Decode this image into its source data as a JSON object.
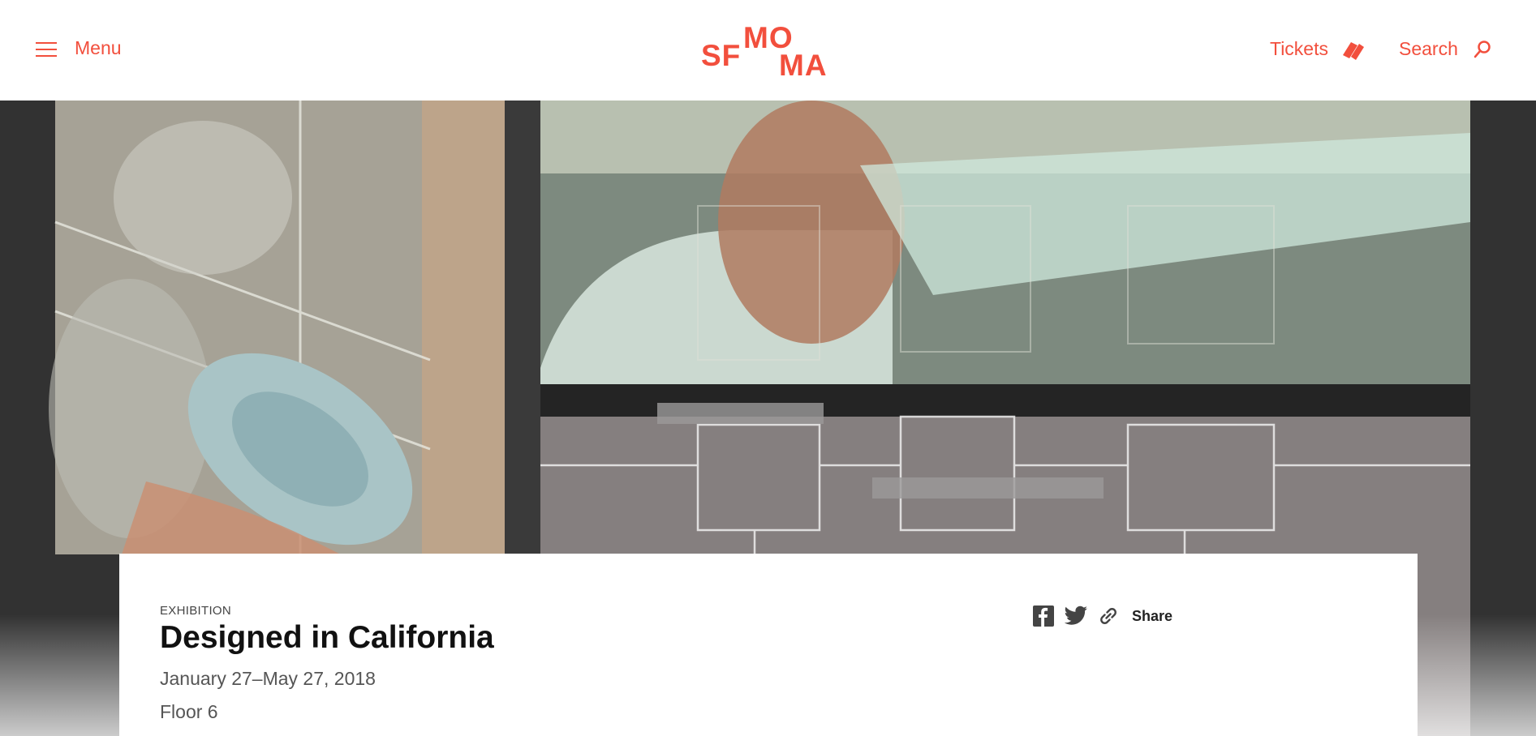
{
  "header": {
    "menu_label": "Menu",
    "logo": {
      "part1": "SF",
      "part2": "MO",
      "part3": "MA"
    },
    "tickets_label": "Tickets",
    "search_label": "Search"
  },
  "exhibition": {
    "eyebrow": "EXHIBITION",
    "title": "Designed in California",
    "dates": "January 27–May 27, 2018",
    "floor": "Floor 6"
  },
  "share": {
    "label": "Share",
    "icons": [
      "facebook-icon",
      "twitter-icon",
      "link-icon"
    ]
  },
  "colors": {
    "accent": "#f24f3d",
    "hero_dark": "#333333"
  }
}
